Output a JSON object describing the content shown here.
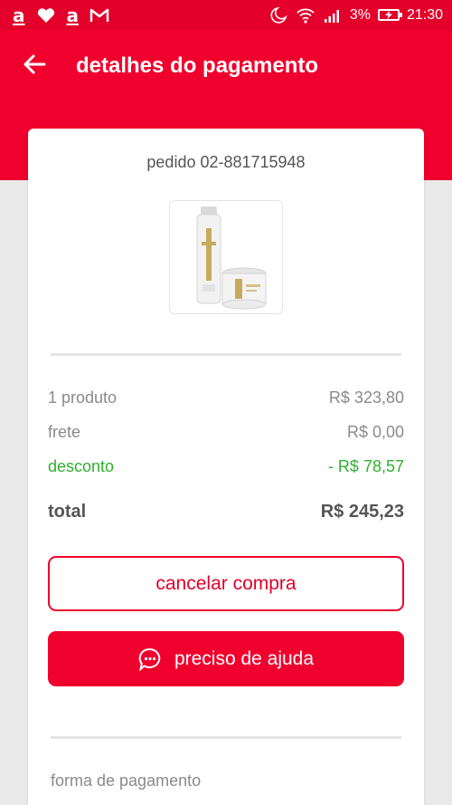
{
  "status_bar": {
    "app_icons": [
      "americanas-a-icon",
      "heart-icon",
      "americanas-a-icon",
      "gmail-icon"
    ],
    "battery": "3%",
    "time": "21:30"
  },
  "header": {
    "title": "detalhes do pagamento",
    "back_icon": "arrow-left-icon"
  },
  "order": {
    "label": "pedido 02-881715948",
    "product_image": "wella-oil-reflections-shampoo-and-mask"
  },
  "summary": {
    "products_label": "1 produto",
    "products_value": "R$ 323,80",
    "shipping_label": "frete",
    "shipping_value": "R$ 0,00",
    "discount_label": "desconto",
    "discount_value": "- R$ 78,57",
    "total_label": "total",
    "total_value": "R$ 245,23"
  },
  "actions": {
    "cancel_label": "cancelar compra",
    "help_label": "preciso de ajuda",
    "help_icon": "chat-bubble-icon"
  },
  "payment": {
    "section_label": "forma de pagamento"
  },
  "colors": {
    "brand_red": "#f0002d",
    "discount_green": "#2fb02f"
  }
}
